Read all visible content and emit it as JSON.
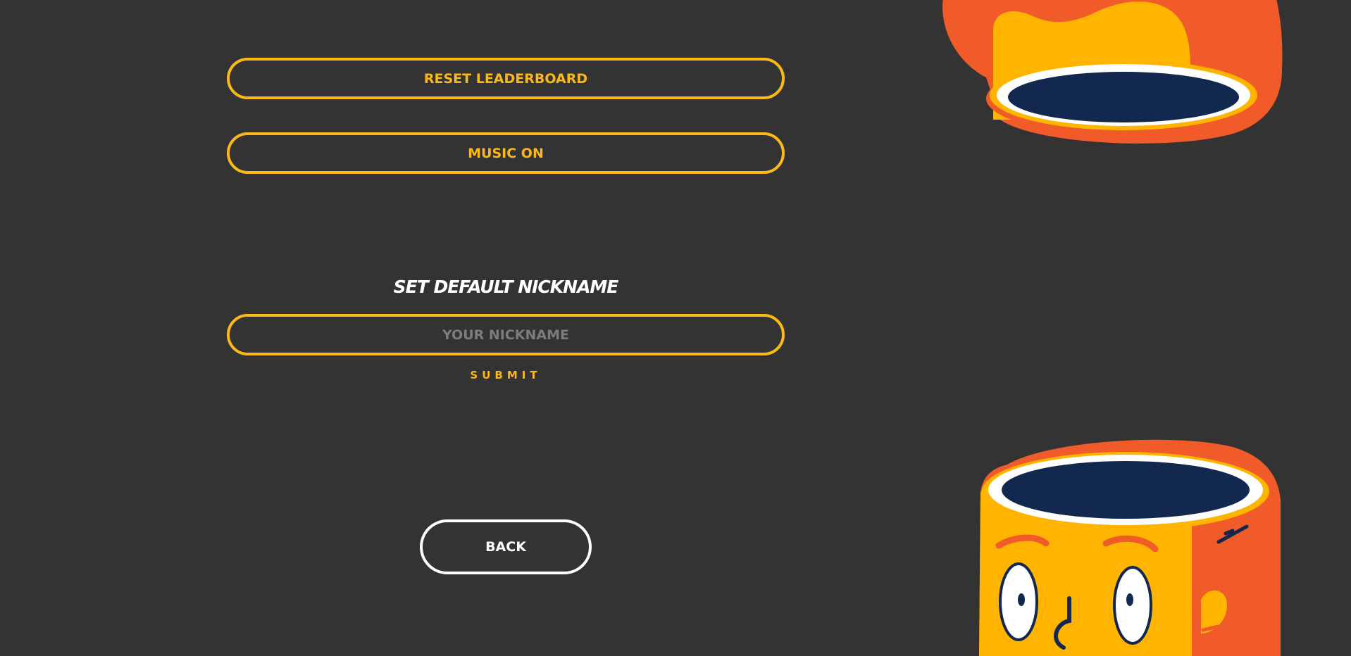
{
  "colors": {
    "background": "#333333",
    "accent": "#fbb919",
    "back_border": "#ffffff",
    "mascot_orange": "#f15a29",
    "mascot_yellow": "#ffb400",
    "mascot_navy": "#12284f"
  },
  "settings": {
    "reset_leaderboard_label": "RESET LEADERBOARD",
    "music_label": "MUSIC ON"
  },
  "nickname": {
    "title": "SET DEFAULT NICKNAME",
    "value": "",
    "placeholder": "YOUR NICKNAME",
    "submit_label": "SUBMIT"
  },
  "navigation": {
    "back_label": "BACK"
  },
  "decorations": {
    "top_character_icon": "cup-character-top-icon",
    "bottom_character_icon": "cup-character-face-icon"
  }
}
